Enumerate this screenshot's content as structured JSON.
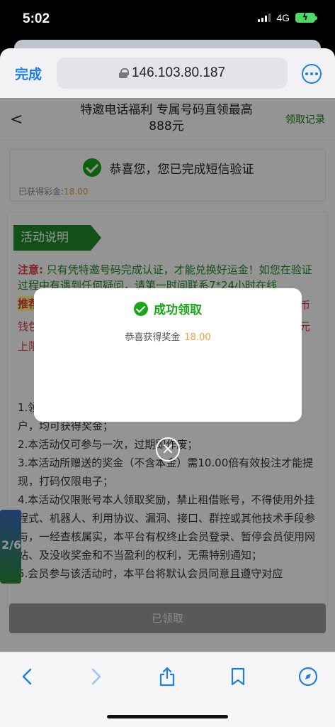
{
  "status": {
    "time": "5:02",
    "network": "4G"
  },
  "browser": {
    "done_label": "完成",
    "url": "146.103.80.187"
  },
  "nav": {
    "title": "特邀电话福利 专属号码直领最高888元",
    "record_label": "领取记录"
  },
  "verify": {
    "message": "恭喜您，您已完成短信验证",
    "earned_label": "已获得彩金:",
    "earned_amount": "18.00"
  },
  "activity": {
    "tag": "活动说明",
    "notice_label": "注意:",
    "notice_text": "只有凭特邀号码完成认证，才能兑换好运金！如您在验证过程中有遇到任何疑问，请第一时间联系7*24小时在线",
    "recommend_fragment": "推荐",
    "side_fragments": [
      "币",
      "元"
    ],
    "line_fragments": [
      "钱包",
      "上限"
    ],
    "rules": [
      "1.领",
      "户，均可获得奖金；",
      "2.本活动仅可参与一次，过期即作废；",
      "3.本活动所赠送的奖金（不含本金）需10.00倍有效投注才能提现，打码仅限电子；",
      "4.本活动仅限账号本人领取奖励，禁止租借账号，不得使用外挂程式、机器人、利用协议、漏洞、接口、群控或其他技术手段参与，一经查核属实，本平台有权终止会员登录、暂停会员使用网站、及没收奖金和不当盈利的权利，无需特别通知；",
      "5.会员参与该活动时，本平台将默认会员同意且遵守对应"
    ],
    "thumb_label": "2/6"
  },
  "claim_button": "已领取",
  "modal": {
    "title": "成功领取",
    "body_label": "恭喜获得奖金",
    "body_amount": "18.00",
    "close_icon": "×"
  },
  "toolbar": {
    "back_icon": "‹",
    "forward_icon": "›",
    "share_icon": "share-icon",
    "bookmark_icon": "bookmark-icon",
    "compass_icon": "compass-icon"
  }
}
